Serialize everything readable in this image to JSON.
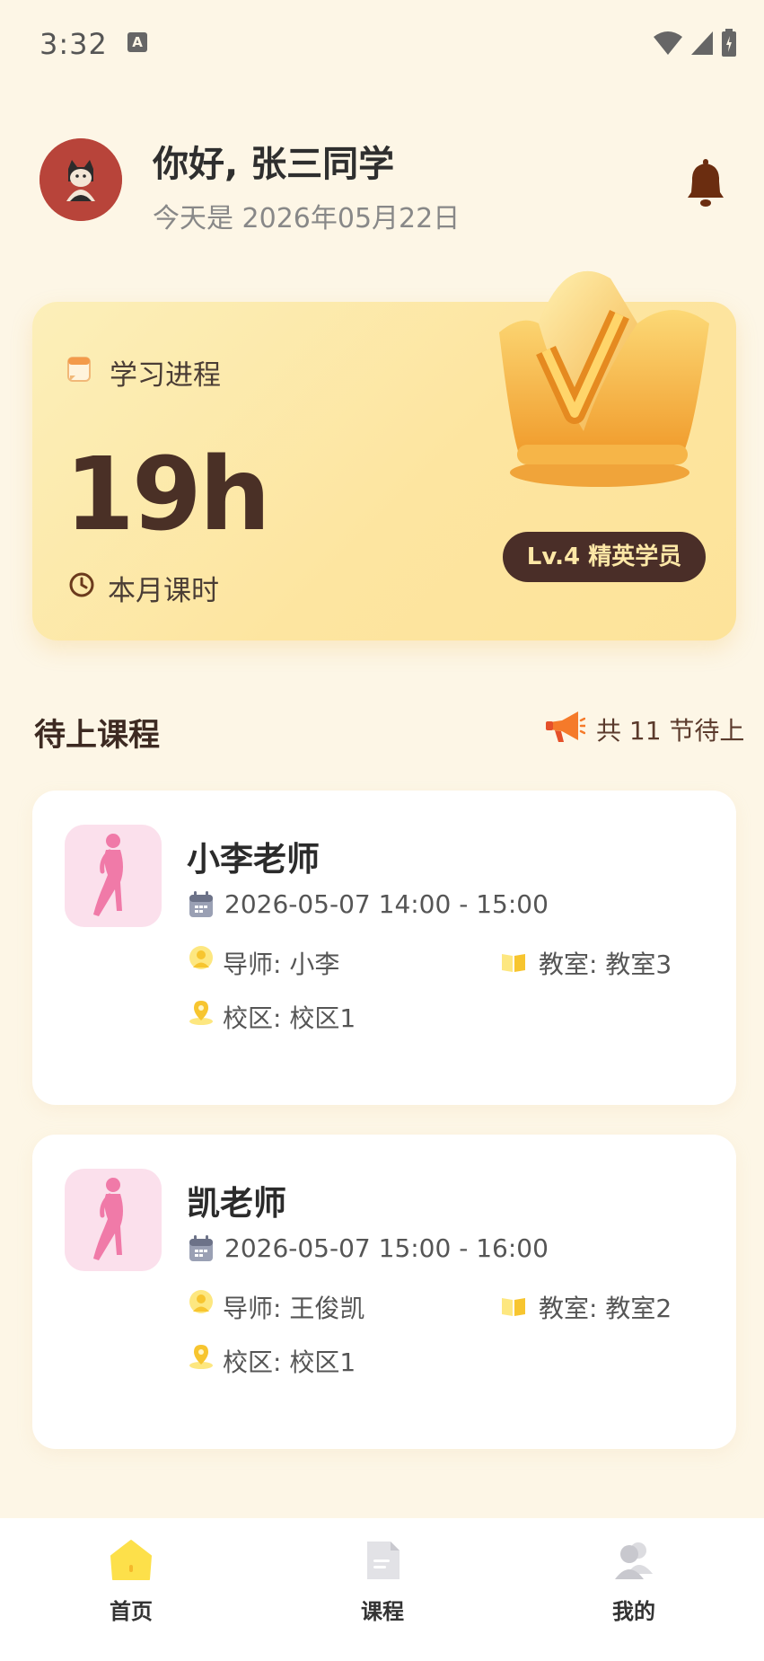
{
  "status_bar": {
    "time": "3:32",
    "indicator": "A"
  },
  "header": {
    "greeting": "你好, 张三同学",
    "date": "今天是 2026年05月22日"
  },
  "progress": {
    "title": "学习进程",
    "hours": "19h",
    "period_label": "本月课时",
    "level": "Lv.4 精英学员"
  },
  "upcoming": {
    "title": "待上课程",
    "count_text": "共 11 节待上"
  },
  "courses": [
    {
      "name": "小李老师",
      "time": "2026-05-07 14:00 - 15:00",
      "teacher": "导师: 小李",
      "room": "教室: 教室3",
      "campus": "校区: 校区1"
    },
    {
      "name": "凯老师",
      "time": "2026-05-07 15:00 - 16:00",
      "teacher": "导师: 王俊凯",
      "room": "教室: 教室2",
      "campus": "校区: 校区1"
    }
  ],
  "nav": [
    {
      "label": "首页",
      "icon": "home-icon",
      "active": true
    },
    {
      "label": "课程",
      "icon": "document-icon",
      "active": false
    },
    {
      "label": "我的",
      "icon": "users-icon",
      "active": false
    }
  ],
  "colors": {
    "background": "#fdf6e6",
    "card_gradient_start": "#fcefb9",
    "card_gradient_end": "#fde39a",
    "badge": "#4a2e28",
    "accent_yellow": "#fde04a",
    "thumb_pink": "#fbe0ec"
  }
}
